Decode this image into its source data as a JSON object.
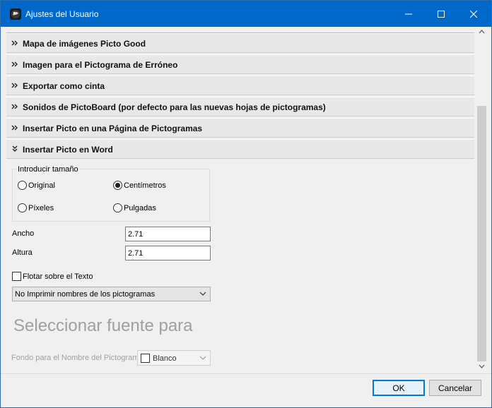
{
  "window": {
    "title": "Ajustes del Usuario",
    "accent_color": "#0068c8"
  },
  "sections": [
    {
      "label": "Mapa de imágenes Picto Good",
      "expanded": false
    },
    {
      "label": "Imagen para el Pictograma de Erróneo",
      "expanded": false
    },
    {
      "label": "Exportar como cinta",
      "expanded": false
    },
    {
      "label": "Sonidos de PictoBoard (por defecto para las nuevas hojas de pictogramas)",
      "expanded": false
    },
    {
      "label": "Insertar Picto en una Página de Pictogramas",
      "expanded": false
    },
    {
      "label": "Insertar Picto en Word",
      "expanded": true
    }
  ],
  "word_section": {
    "size_group_title": "Introducir tamaño",
    "size_options": [
      {
        "label": "Original",
        "selected": false
      },
      {
        "label": "Centímetros",
        "selected": true
      },
      {
        "label": "Píxeles",
        "selected": false
      },
      {
        "label": "Pulgadas",
        "selected": false
      }
    ],
    "width_label": "Ancho",
    "width_value": "2.71",
    "height_label": "Altura",
    "height_value": "2.71",
    "float_label": "Flotar sobre el Texto",
    "float_checked": false,
    "print_names_select": "No Imprimir nombres de los pictogramas",
    "font_select_label": "Seleccionar fuente para",
    "background_label": "Fondo para el Nombre del Pictograma",
    "background_value": "Blanco"
  },
  "footer": {
    "ok_label": "OK",
    "cancel_label": "Cancelar"
  }
}
